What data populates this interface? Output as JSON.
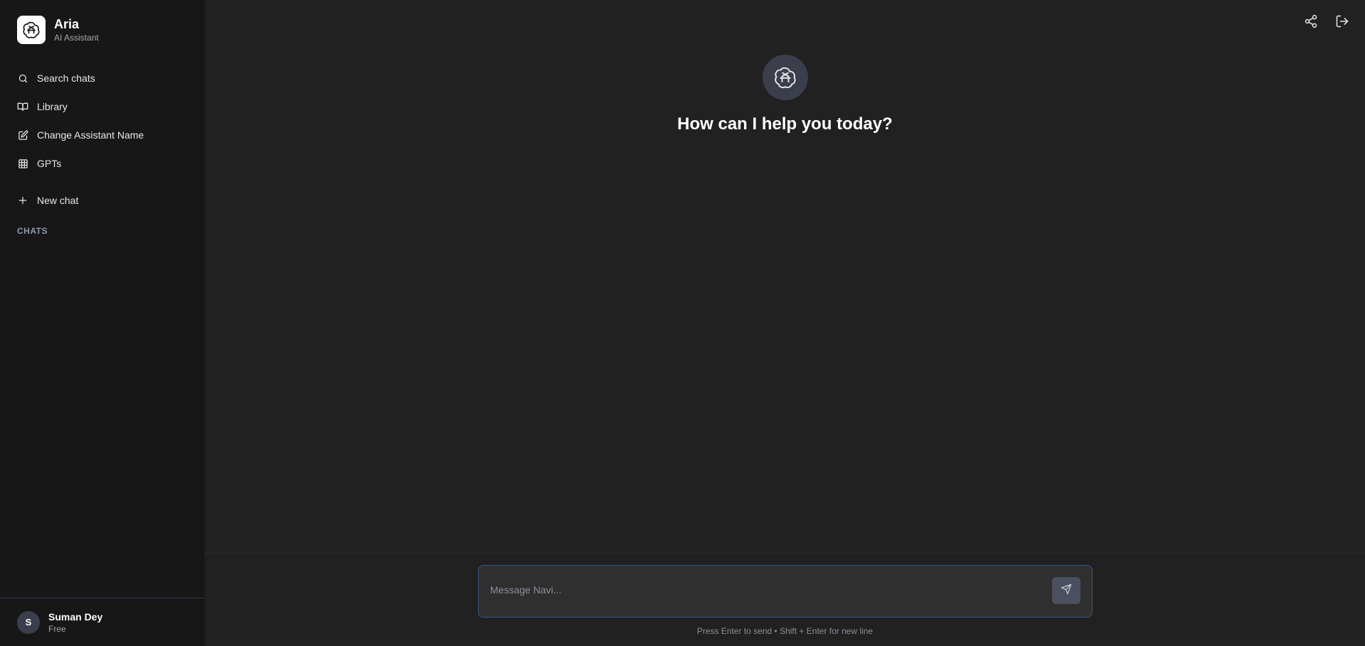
{
  "brand": {
    "name": "Aria",
    "subtitle": "AI Assistant",
    "logo_icon": "openai-knot-icon"
  },
  "sidebar": {
    "items": [
      {
        "label": "Search chats",
        "icon": "search-icon"
      },
      {
        "label": "Library",
        "icon": "book-icon"
      },
      {
        "label": "Change Assistant Name",
        "icon": "edit-icon"
      },
      {
        "label": "GPTs",
        "icon": "grid-icon"
      }
    ],
    "new_chat": {
      "label": "New chat",
      "icon": "plus-icon"
    },
    "section_label": "CHATS"
  },
  "user": {
    "initial": "S",
    "name": "Suman Dey",
    "plan": "Free"
  },
  "header": {
    "share_icon": "share-icon",
    "logout_icon": "logout-icon"
  },
  "hero": {
    "title": "How can I help you today?"
  },
  "composer": {
    "placeholder": "Message Navi...",
    "value": "",
    "send_icon": "send-icon",
    "hint": "Press Enter to send • Shift + Enter for new line"
  },
  "colors": {
    "sidebar_bg": "#171717",
    "main_bg": "#212121",
    "composer_border": "#2d5a8c",
    "accent_muted": "#4a5060"
  }
}
